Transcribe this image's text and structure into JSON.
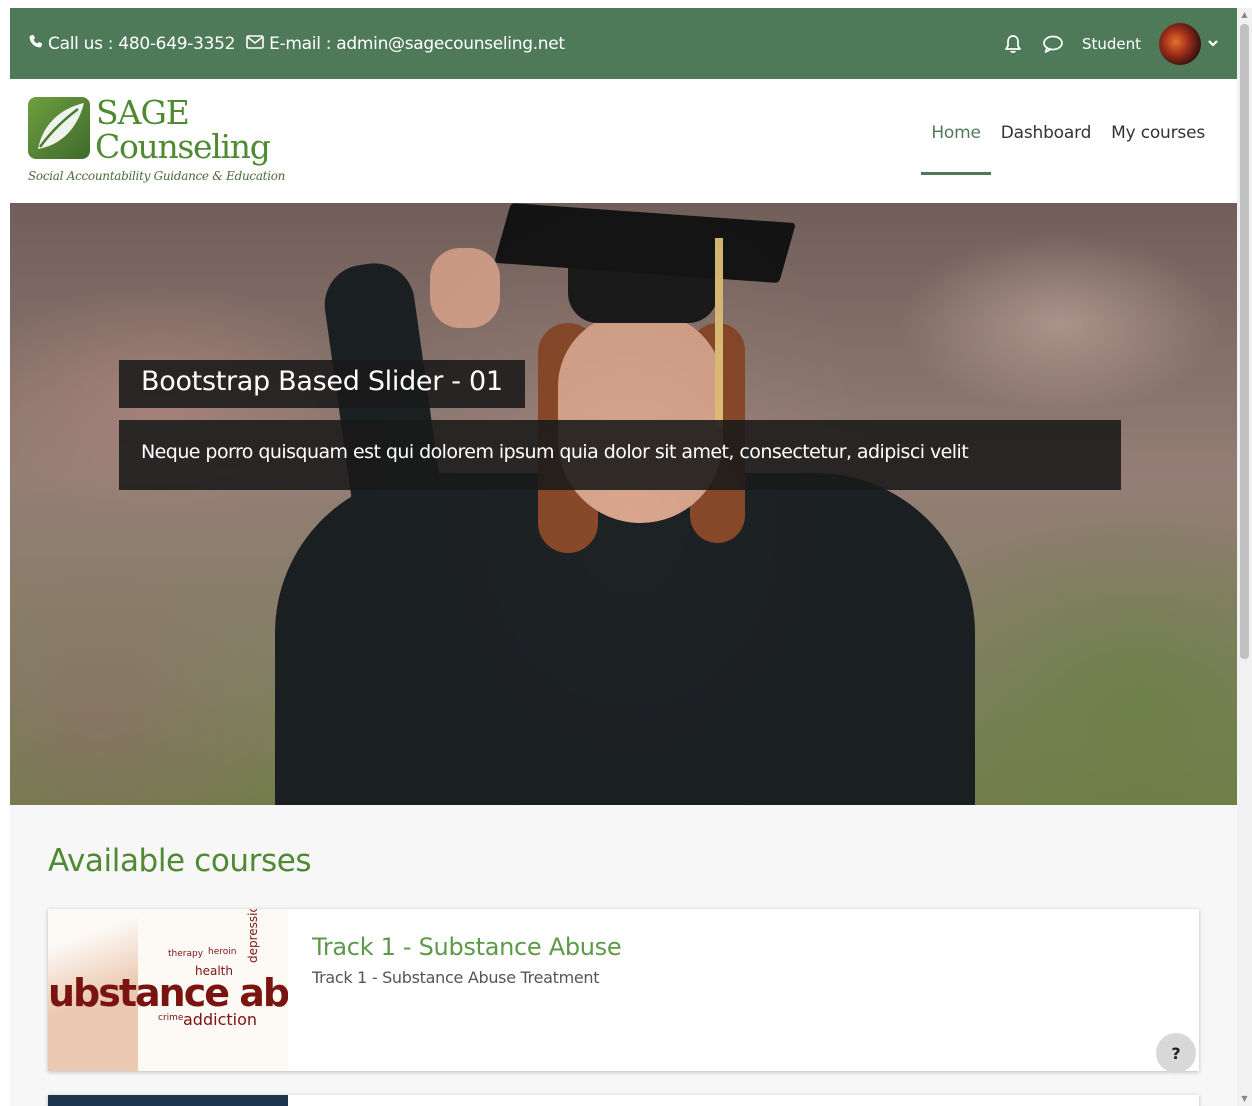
{
  "topbar": {
    "phone_label": "Call us : 480-649-3352",
    "email_label": "E-mail : admin@sagecounseling.net",
    "username": "Student"
  },
  "logo": {
    "line1": "SAGE",
    "line2": "Counseling",
    "tagline": "Social Accountability Guidance & Education"
  },
  "nav": {
    "items": [
      {
        "label": "Home",
        "active": true
      },
      {
        "label": "Dashboard",
        "active": false
      },
      {
        "label": "My courses",
        "active": false
      }
    ]
  },
  "slider": {
    "title": "Bootstrap Based Slider - 01",
    "text": "Neque porro quisquam est qui dolorem ipsum quia dolor sit amet, consectetur, adipisci velit"
  },
  "courses": {
    "heading": "Available courses",
    "items": [
      {
        "title": "Track 1 - Substance Abuse",
        "subtitle": "Track 1 - Substance Abuse Treatment",
        "thumb_words": {
          "main": "ubstance abus",
          "w1": "health",
          "w2": "addiction",
          "w3": "crime",
          "w4": "depression",
          "w5": "therapy",
          "w6": "heroin"
        }
      }
    ]
  },
  "help": {
    "label": "?"
  },
  "colors": {
    "topbar_bg": "#4f7a5a",
    "brand_green": "#4f8a33",
    "course_title": "#5c9a48"
  }
}
